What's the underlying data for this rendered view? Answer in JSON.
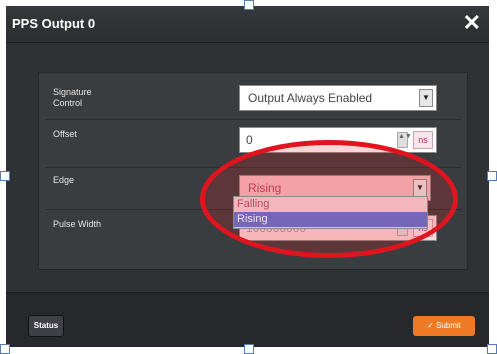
{
  "dialog": {
    "title": "PPS Output 0",
    "close_glyph": "✕"
  },
  "form": {
    "signature_control": {
      "label": "Signature Control",
      "value": "Output Always Enabled"
    },
    "offset": {
      "label": "Offset",
      "value": "0",
      "unit": "ns"
    },
    "edge": {
      "label": "Edge",
      "value": "Rising",
      "options": [
        "Falling",
        "Rising"
      ],
      "selected": "Rising"
    },
    "pulse_width": {
      "label": "Pulse Width",
      "value": "100000000",
      "unit": "ns"
    }
  },
  "footer": {
    "status_label": "Status",
    "submit_label": "✓ Submit"
  },
  "icons": {
    "dropdown_arrow": "▼",
    "spinner": "▲▼"
  },
  "colors": {
    "highlight_ellipse": "#e0141e",
    "submit": "#ef7a26",
    "selected_option": "#7466b8"
  }
}
